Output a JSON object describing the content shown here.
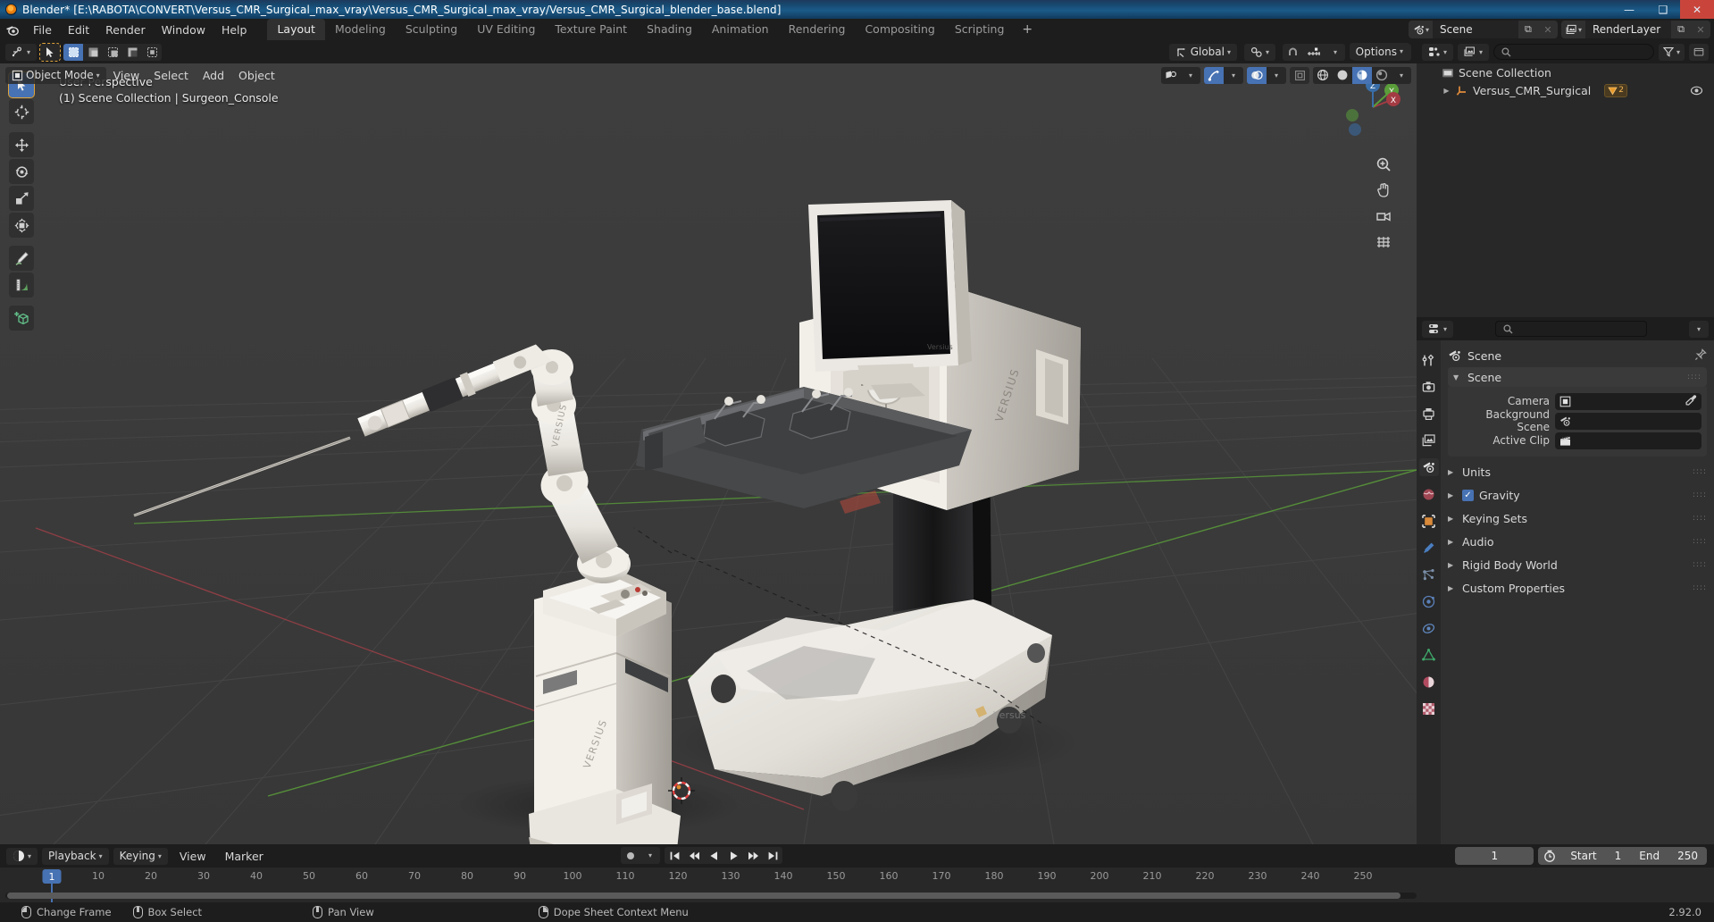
{
  "window": {
    "title": "Blender* [E:\\RABOTA\\CONVERT\\Versus_CMR_Surgical_max_vray\\Versus_CMR_Surgical_max_vray/Versus_CMR_Surgical_blender_base.blend]",
    "minimize": "—",
    "maximize": "❑",
    "close": "✕"
  },
  "topbar": {
    "menus": [
      "File",
      "Edit",
      "Render",
      "Window",
      "Help"
    ],
    "workspaces": [
      {
        "label": "Layout",
        "active": true
      },
      {
        "label": "Modeling",
        "active": false
      },
      {
        "label": "Sculpting",
        "active": false
      },
      {
        "label": "UV Editing",
        "active": false
      },
      {
        "label": "Texture Paint",
        "active": false
      },
      {
        "label": "Shading",
        "active": false
      },
      {
        "label": "Animation",
        "active": false
      },
      {
        "label": "Rendering",
        "active": false
      },
      {
        "label": "Compositing",
        "active": false
      },
      {
        "label": "Scripting",
        "active": false
      }
    ],
    "add_workspace": "+",
    "scene_name": "Scene",
    "view_layer_name": "RenderLayer",
    "new_copy": "⧉",
    "unlink": "✕"
  },
  "toolrow": {
    "editor_type": "editor-type-icon",
    "cursor_tool": "select-cursor-icon",
    "select_modes": [
      {
        "name": "select-set",
        "active": true
      },
      {
        "name": "select-extend",
        "active": false
      },
      {
        "name": "select-subtract",
        "active": false
      },
      {
        "name": "select-invert",
        "active": false
      },
      {
        "name": "select-intersect",
        "active": false
      }
    ]
  },
  "viewport": {
    "mode": "Object Mode",
    "menus": [
      "View",
      "Select",
      "Add",
      "Object"
    ],
    "transform_orientation": "Global",
    "snap_label": "snap-magnet-icon",
    "proportional_label": "proportional-editing-icon",
    "options_label": "Options",
    "overlay_line1": "User Perspective",
    "overlay_line2": "(1) Scene Collection | Surgeon_Console",
    "shading_modes": [
      {
        "name": "wireframe",
        "active": false
      },
      {
        "name": "solid",
        "active": false
      },
      {
        "name": "material-preview",
        "active": true
      },
      {
        "name": "rendered",
        "active": false
      }
    ],
    "tools": [
      {
        "name": "tweak-tool",
        "active": true
      },
      {
        "name": "cursor-tool",
        "active": false
      },
      {
        "name": "move-tool",
        "active": false
      },
      {
        "name": "rotate-tool",
        "active": false
      },
      {
        "name": "scale-tool",
        "active": false
      },
      {
        "name": "transform-tool",
        "active": false
      },
      {
        "name": "annotate-tool",
        "active": false
      },
      {
        "name": "measure-tool",
        "active": false
      },
      {
        "name": "add-cube-tool",
        "active": false
      }
    ],
    "gizmo_axes": [
      "X",
      "Y",
      "Z"
    ],
    "nav_buttons": [
      "zoom-icon",
      "pan-icon",
      "camera-icon",
      "ortho-persp-icon"
    ]
  },
  "outliner": {
    "display_mode": "view-layer-icon",
    "filter_icon": "filter-icon",
    "search_placeholder": "",
    "root": "Scene Collection",
    "items": [
      {
        "label": "Versus_CMR_Surgical",
        "badge": "2",
        "visible": true
      }
    ]
  },
  "properties": {
    "search_placeholder": "",
    "breadcrumb": "Scene",
    "tabs": [
      {
        "name": "tool",
        "active": false
      },
      {
        "name": "render",
        "active": false
      },
      {
        "name": "output",
        "active": false
      },
      {
        "name": "view-layer",
        "active": false
      },
      {
        "name": "scene",
        "active": true
      },
      {
        "name": "world",
        "active": false
      },
      {
        "name": "object",
        "active": false
      },
      {
        "name": "modifiers",
        "active": false
      },
      {
        "name": "particles",
        "active": false
      },
      {
        "name": "physics",
        "active": false
      },
      {
        "name": "constraints",
        "active": false
      },
      {
        "name": "data",
        "active": false
      },
      {
        "name": "material",
        "active": false
      },
      {
        "name": "texture",
        "active": false
      }
    ],
    "panels": [
      {
        "label": "Scene",
        "open": true,
        "checkbox": null
      },
      {
        "label": "Units",
        "open": false,
        "checkbox": null
      },
      {
        "label": "Gravity",
        "open": false,
        "checkbox": true
      },
      {
        "label": "Keying Sets",
        "open": false,
        "checkbox": null
      },
      {
        "label": "Audio",
        "open": false,
        "checkbox": null
      },
      {
        "label": "Rigid Body World",
        "open": false,
        "checkbox": null
      },
      {
        "label": "Custom Properties",
        "open": false,
        "checkbox": null
      }
    ],
    "fields": [
      {
        "label": "Camera",
        "value": "",
        "icon": "camera-object-icon",
        "eyedropper": true
      },
      {
        "label": "Background Scene",
        "value": "",
        "icon": "scene-icon",
        "eyedropper": false
      },
      {
        "label": "Active Clip",
        "value": "",
        "icon": "clip-icon",
        "eyedropper": false
      }
    ]
  },
  "timeline": {
    "editor_icon": "timeline-editor-icon",
    "menus": [
      "Playback",
      "Keying",
      "View",
      "Marker"
    ],
    "auto_key_icon": "record-icon",
    "transport": [
      "jump-start",
      "prev-keyframe",
      "play-reverse",
      "play",
      "next-keyframe",
      "jump-end"
    ],
    "current_frame": "1",
    "start_label": "Start",
    "start_value": "1",
    "end_label": "End",
    "end_value": "250",
    "ticks": [
      10,
      20,
      30,
      40,
      50,
      60,
      70,
      80,
      90,
      100,
      110,
      120,
      130,
      140,
      150,
      160,
      170,
      180,
      190,
      200,
      210,
      220,
      230,
      240,
      250
    ],
    "playhead_frame": "1"
  },
  "statusbar": {
    "items": [
      {
        "mouse": "left",
        "label": "Change Frame"
      },
      {
        "mouse": "middle",
        "label": "Box Select"
      },
      {
        "mouse": "middle2",
        "label": "Pan View"
      },
      {
        "mouse": "right",
        "label": "Dope Sheet Context Menu"
      }
    ],
    "version": "2.92.0"
  },
  "colors": {
    "accent": "#4772b3",
    "panel": "#303030",
    "header": "#1d1d1d",
    "viewport": "#3b3b3b",
    "orange": "#e0a43a",
    "axis_x": "#a33b43",
    "axis_y": "#5a9e3a"
  }
}
